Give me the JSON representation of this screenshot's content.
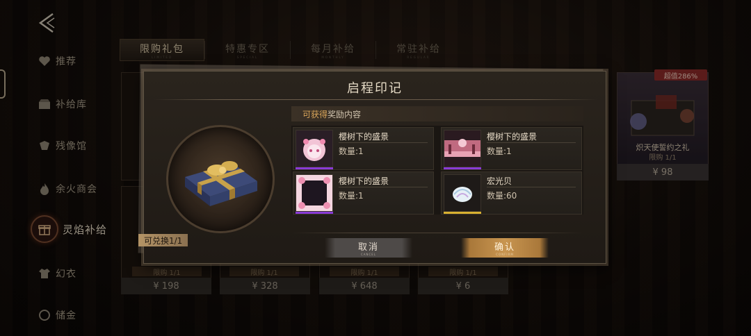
{
  "nav": {
    "sidebar": [
      {
        "label": "推荐",
        "icon": "heart-icon",
        "active": false
      },
      {
        "label": "补给库",
        "icon": "chest-icon",
        "active": false
      },
      {
        "label": "残像馆",
        "icon": "gallery-icon",
        "active": false
      },
      {
        "label": "余火商会",
        "icon": "flame-icon",
        "active": false
      },
      {
        "label": "灵焰补给",
        "icon": "gift-icon",
        "active": true
      },
      {
        "label": "幻衣",
        "icon": "outfit-icon",
        "active": false
      },
      {
        "label": "储金",
        "icon": "coin-icon",
        "active": false
      }
    ]
  },
  "tabs": [
    {
      "label": "限购礼包",
      "sub": "LIMITED",
      "active": true
    },
    {
      "label": "特惠专区",
      "sub": "SPECIAL",
      "active": false
    },
    {
      "label": "每月补给",
      "sub": "MONTHLY",
      "active": false
    },
    {
      "label": "常驻补给",
      "sub": "REGULAR",
      "active": false
    }
  ],
  "background_cards": {
    "prices": [
      "¥ 198",
      "¥ 328",
      "¥ 648",
      "¥ 6"
    ],
    "limits": [
      "限购 1/1",
      "限购 1/1",
      "限购 1/1",
      "限购 1/1"
    ],
    "right_card": {
      "badge": "超值286%",
      "title": "炽天使誓约之礼",
      "limit": "限购 1/1",
      "price": "¥ 98"
    }
  },
  "dialog": {
    "title": "启程印记",
    "redeem_badge": "可兑换1/1",
    "rewards_header_highlight": "可获得",
    "rewards_header_rest": "奖励内容",
    "quantity_prefix": "数量:",
    "rewards": [
      {
        "name": "樱树下的盛景",
        "quantity_text": "数量:1",
        "quantity": 1,
        "rarity_color": "#8a3ad8",
        "icon": "sakura-avatar-icon"
      },
      {
        "name": "樱树下的盛景",
        "quantity_text": "数量:1",
        "quantity": 1,
        "rarity_color": "#8a3ad8",
        "icon": "sakura-scene-icon"
      },
      {
        "name": "樱树下的盛景",
        "quantity_text": "数量:1",
        "quantity": 1,
        "rarity_color": "#8a3ad8",
        "icon": "sakura-frame-icon"
      },
      {
        "name": "宏光贝",
        "quantity_text": "数量:60",
        "quantity": 60,
        "rarity_color": "#d8b030",
        "icon": "shell-icon"
      }
    ],
    "cancel_label": "取消",
    "cancel_sub": "CANCEL",
    "confirm_label": "确认",
    "confirm_sub": "CONFIRM"
  }
}
